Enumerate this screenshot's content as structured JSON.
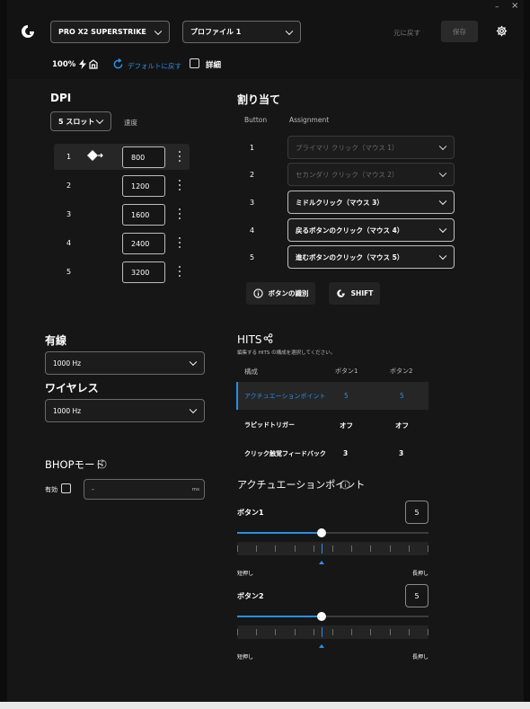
{
  "window": {
    "device": "PRO X2 SUPERSTRIKE",
    "profile": "プロファイル 1",
    "revert": "元に戻す",
    "save": "保存",
    "battery": "100%",
    "reset_default": "デフォルトに戻す",
    "details": "詳細",
    "minimize": "–",
    "close": "×"
  },
  "dpi": {
    "title": "DPI",
    "slot_select": "5 スロット",
    "speed_label": "速度",
    "slots": [
      {
        "index": "1",
        "value": "800"
      },
      {
        "index": "2",
        "value": "1200"
      },
      {
        "index": "3",
        "value": "1600"
      },
      {
        "index": "4",
        "value": "2400"
      },
      {
        "index": "5",
        "value": "3200"
      }
    ]
  },
  "assignment": {
    "title": "割り当て",
    "col_button": "Button",
    "col_assignment": "Assignment",
    "rows": [
      {
        "num": "1",
        "value": "プライマリ クリック（マウス 1）"
      },
      {
        "num": "2",
        "value": "セカンダリ クリック（マウス 2）"
      },
      {
        "num": "3",
        "value": "ミドルクリック（マウス 3）"
      },
      {
        "num": "4",
        "value": "戻るボタンのクリック（マウス 4）"
      },
      {
        "num": "5",
        "value": "進むボタンのクリック（マウス 5）"
      }
    ],
    "identify_button": "ボタンの識別",
    "shift_button": "SHIFT"
  },
  "wired": {
    "title": "有線",
    "rate": "1000 Hz"
  },
  "wireless": {
    "title": "ワイヤレス",
    "rate": "1000 Hz"
  },
  "bhop": {
    "title": "BHOPモード",
    "enabled_label": "有効",
    "value": "-",
    "unit": "ms"
  },
  "hits": {
    "title": "HITS",
    "subtitle": "編集する HITS の構成を選択してください。",
    "col_config": "構成",
    "col_b1": "ボタン1",
    "col_b2": "ボタン2",
    "rows": [
      {
        "name": "アクチュエーションポイント",
        "b1": "5",
        "b2": "5"
      },
      {
        "name": "ラピッドトリガー",
        "b1": "オフ",
        "b2": "オフ"
      },
      {
        "name": "クリック触覚フィードバック",
        "b1": "3",
        "b2": "3"
      }
    ]
  },
  "actuation": {
    "title": "アクチュエーションポイント",
    "sliders": [
      {
        "label": "ボタン1",
        "value": "5",
        "level": 0.44,
        "short": "短押し",
        "long": "長押し"
      },
      {
        "label": "ボタン2",
        "value": "5",
        "level": 0.44,
        "short": "短押し",
        "long": "長押し"
      }
    ]
  },
  "colors": {
    "accent": "#2c8de8",
    "background": "#161616"
  }
}
